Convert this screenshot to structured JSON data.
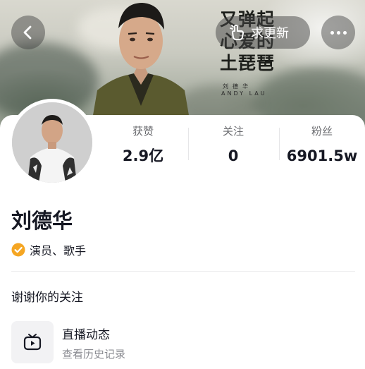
{
  "header": {
    "back_icon": "chevron-left-icon",
    "update_button": {
      "label": "求更新",
      "icon": "hand-point-icon"
    },
    "more_icon": "ellipsis-icon",
    "poster": {
      "title_lines": [
        "又弹起",
        "心爱的",
        "土琵琶"
      ],
      "artist_cn": "刘德华",
      "artist_en": "ANDY LAU"
    }
  },
  "profile": {
    "name": "刘德华",
    "verified_icon": "verified-check-icon",
    "verified_color": "#f5a623",
    "verified_text": "演员、歌手",
    "stats": [
      {
        "label": "获赞",
        "value": "2.9亿"
      },
      {
        "label": "关注",
        "value": "0"
      },
      {
        "label": "粉丝",
        "value": "6901.5w"
      }
    ],
    "bio": "谢谢你的关注"
  },
  "live": {
    "icon": "tv-play-icon",
    "title": "直播动态",
    "subtitle": "查看历史记录"
  }
}
